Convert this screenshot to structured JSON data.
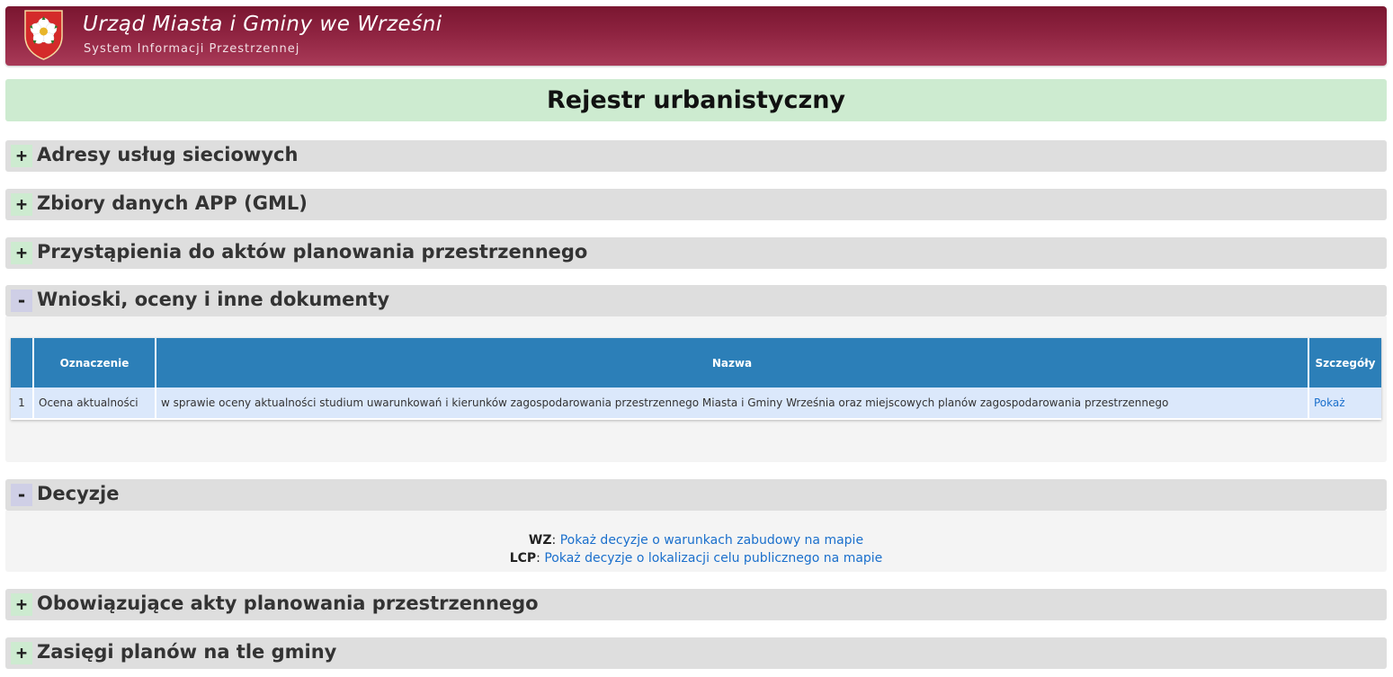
{
  "header": {
    "title": "Urząd Miasta i Gminy we Wrześni",
    "subtitle": "System Informacji Przestrzennej",
    "brand_color": "#8e2340"
  },
  "page_title": "Rejestr urbanistyczny",
  "sections": [
    {
      "toggle": "+",
      "title": "Adresy usług sieciowych",
      "expanded": false
    },
    {
      "toggle": "+",
      "title": "Zbiory danych APP (GML)",
      "expanded": false
    },
    {
      "toggle": "+",
      "title": "Przystąpienia do aktów planowania przestrzennego",
      "expanded": false
    },
    {
      "toggle": "-",
      "title": "Wnioski, oceny i inne dokumenty",
      "expanded": true
    },
    {
      "toggle": "-",
      "title": "Decyzje",
      "expanded": true
    },
    {
      "toggle": "+",
      "title": "Obowiązujące akty planowania przestrzennego",
      "expanded": false
    },
    {
      "toggle": "+",
      "title": "Zasięgi planów na tle gminy",
      "expanded": false
    }
  ],
  "documents_table": {
    "columns": [
      "",
      "Oznaczenie",
      "Nazwa",
      "Szczegóły"
    ],
    "rows": [
      {
        "num": "1",
        "oznaczenie": "Ocena aktualności",
        "nazwa": "w sprawie oceny aktualności studium uwarunkowań i kierunków zagospodarowania przestrzennego Miasta i Gminy Września oraz miejscowych planów zagospodarowania przestrzennego",
        "szczegoly": "Pokaż"
      }
    ]
  },
  "decisions": {
    "wz_label": "WZ",
    "wz_link": "Pokaż decyzje o warunkach zabudowy na mapie",
    "lcp_label": "LCP",
    "lcp_link": "Pokaż decyzje o lokalizacji celu publicznego na mapie"
  },
  "colors": {
    "title_bar": "#cdebd0",
    "section_bar": "#dedede",
    "table_header": "#2c7fb8",
    "table_row": "#dbe8fb",
    "link": "#1a6fcc"
  },
  "icons": {
    "crest": "rose-crest-icon"
  }
}
